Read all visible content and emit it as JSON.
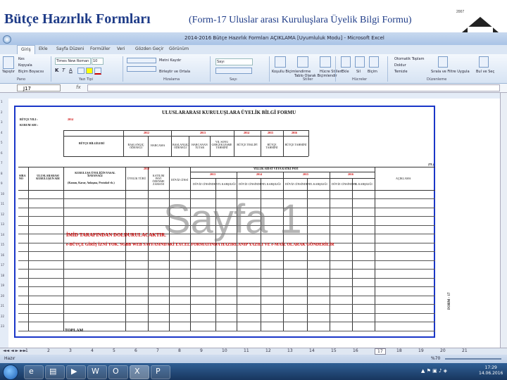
{
  "slide": {
    "title": "Bütçe Hazırlık Formları",
    "subtitle": "(Form-17 Uluslar arası Kuruluşlara Üyelik Bilgi Formu)",
    "logo_text": "2007"
  },
  "excel": {
    "window_title": "2014-2016 Bütçe Hazırlık Formları AÇIKLAMA [Uyumluluk Modu] - Microsoft Excel",
    "tabs": [
      "Giriş",
      "Ekle",
      "Sayfa Düzeni",
      "Formüller",
      "Veri",
      "Gözden Geçir",
      "Görünüm"
    ],
    "active_tab": "Giriş",
    "ribbon": {
      "clipboard": {
        "paste": "Yapıştır",
        "cut": "Kes",
        "copy": "Kopyala",
        "format_painter": "Biçim Boyacısı",
        "label": "Pano"
      },
      "font": {
        "name": "Times New Roman",
        "size": "10",
        "label": "Yazı Tipi"
      },
      "alignment": {
        "wrap": "Metni Kaydır",
        "merge": "Birleştir ve Ortala",
        "label": "Hizalama"
      },
      "number": {
        "format": "Sayı",
        "label": "Sayı"
      },
      "styles": {
        "conditional": "Koşullu Biçimlendirme",
        "table": "Tablo Olarak Biçimlendir",
        "cell": "Hücre Stilleri",
        "label": "Stiller"
      },
      "cells": {
        "insert": "Ekle",
        "delete": "Sil",
        "format": "Biçim",
        "label": "Hücreler"
      },
      "editing": {
        "autosum": "Otomatik Toplam",
        "fill": "Doldur",
        "clear": "Temizle",
        "sort": "Sırala ve Filtre Uygula",
        "find": "Bul ve Seç",
        "label": "Düzenleme"
      }
    },
    "name_box": "J17",
    "fx": "fx",
    "row_numbers": [
      "1",
      "2",
      "3",
      "4",
      "5",
      "6",
      "7",
      "8",
      "9",
      "10",
      "11",
      "12",
      "13",
      "14",
      "15",
      "16",
      "17",
      "18",
      "19",
      "20",
      "21",
      "22",
      "23"
    ],
    "sheet_tabs": [
      "1",
      "2",
      "3",
      "4",
      "5",
      "6",
      "7",
      "8",
      "9",
      "10",
      "11",
      "12",
      "13",
      "14",
      "15",
      "16",
      "17",
      "18",
      "19",
      "20",
      "21"
    ],
    "active_sheet": "17",
    "status": "Hazır",
    "zoom": "%70"
  },
  "form": {
    "title": "ULUSLARARASI KURULUŞLARA ÜYELİK BİLGİ FORMU",
    "butce_yili_label": "BÜTÇE YILI :",
    "butce_yili_value": "2014",
    "kurum_label": "KURUM ADI :",
    "top_table": {
      "row_label": "BÜTÇE BİLGİLERİ",
      "years": [
        "2012",
        "2013",
        "2014",
        "2015",
        "2016"
      ],
      "cols": [
        "BAŞLANGIÇ ÖDENEĞİ",
        "HARCAMA",
        "BAŞLANGIÇ ÖDENEĞİ",
        "HARCANAN TUTAR",
        "YIL SONU GERÇEKLEŞME TAHMİNİ",
        "BÜTÇE TEKLİFİ",
        "BÜTÇE TAHMİNİ",
        "BÜTÇE TAHMİNİ"
      ]
    },
    "unit": "(TL)",
    "main_header": {
      "sira_no": "SIRA NO",
      "kurulus": "ULUSLARARASI KURULUŞUN ADI",
      "ulke": "KURULUŞA ÜYELİĞİN YASAL DAYANAĞI",
      "ulke_detail": "(Kanun, Karar, Anlaşma, Protokol vb.)",
      "uyelik": "ÜYELİK TÜRÜ",
      "katilim": "KATILIM PAYI ÖDENME ZAMANI",
      "doviz": "DÖVİZ CİNSİ",
      "aidat_header": "YILLIK AİDAT VEYA KATKI PAYI",
      "years": [
        "2012",
        "2013",
        "2014",
        "2015",
        "2016"
      ],
      "sub_cols": [
        "DÖVİZ CİNSİNDEN",
        "TL KARŞILIĞI"
      ],
      "aciklama": "AÇIKLAMA"
    },
    "watermark": "Sayfa 1",
    "note1": "İMİD TARAFINDAN DOLDURULACAKTIR.",
    "note2": "e-BÜTÇE GİRİŞ İZNİ YOK. SGBB WEB SAYFASINDAKİ EXCEL FORMATINDA HAZIRLANIP YAZILI VE e-MAİL OLARAK GÖNDERİLİR",
    "total": "TOPLAM",
    "side_label": "FORM - 17"
  },
  "taskbar": {
    "clock_time": "17:29",
    "clock_date": "14.06.2016"
  }
}
